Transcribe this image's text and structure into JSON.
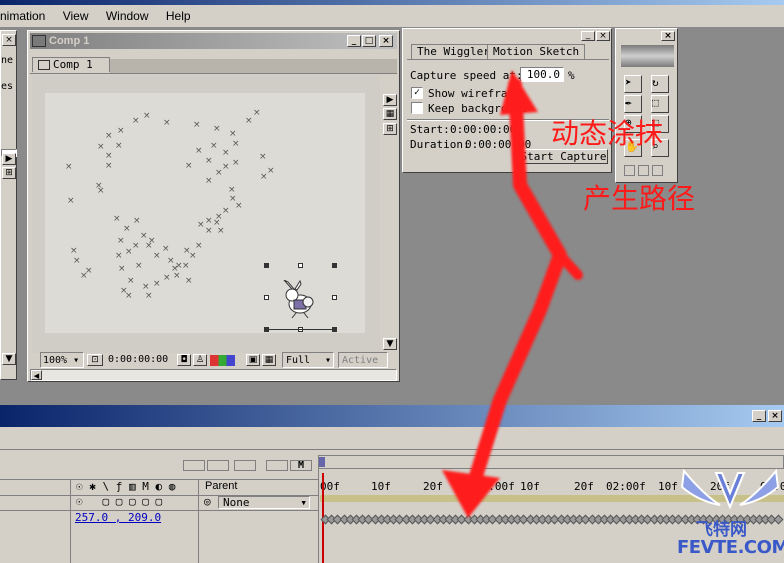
{
  "menu": {
    "items": [
      "nimation",
      "View",
      "Window",
      "Help"
    ]
  },
  "left_panel": {
    "close": "×",
    "item1": "ne",
    "item2": "es"
  },
  "comp_window": {
    "title": "Comp 1",
    "tab": "Comp 1",
    "zoom": "100%",
    "timecode": "0:00:00:00",
    "resolution": "Full",
    "camera": "Active"
  },
  "motion_sketch": {
    "tab_wiggler": "The Wiggler",
    "tab_sketch": "Motion Sketch",
    "capture_label": "Capture speed at:",
    "capture_value": "100.0",
    "capture_unit": "%",
    "show_label": "Show wireframe",
    "show_checked": true,
    "keep_label": "Keep background",
    "keep_checked": false,
    "start_label": "Start:",
    "start_value": "0:00:00:00",
    "duration_label": "Duration:",
    "duration_value": "0:00:00:00",
    "start_capture": "Start Capture"
  },
  "overlay": {
    "caption1": "动态涂抹",
    "caption2": "产生路径",
    "arrow_color": "#ff1a1a"
  },
  "watermark": {
    "line1": "飞特网",
    "line2": "FEVTE.COM"
  },
  "timeline": {
    "parent_header": "Parent",
    "parent_value": "None",
    "parent_icon": "◎",
    "position_value": "257.0 , 209.0",
    "ruler_ticks": [
      "00f",
      "10f",
      "20f",
      "01:00f",
      "10f",
      "20f",
      "02:00f",
      "10f",
      "20f",
      "03:0"
    ],
    "modes": [
      "M"
    ]
  },
  "colors": {
    "title_active": "#0a246a",
    "title_gradient_end": "#a6caf0",
    "panel_bg": "#d4d0c8",
    "comp_bg": "#d8d6d0",
    "link_blue": "#0000c0"
  }
}
